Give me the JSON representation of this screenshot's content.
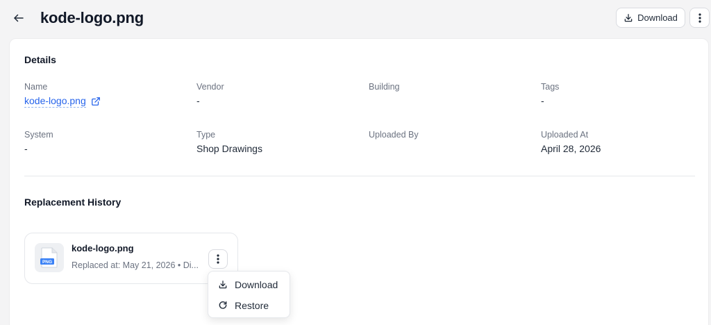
{
  "header": {
    "title": "kode-logo.png",
    "download_label": "Download",
    "icons": {
      "back": "arrow-left-icon",
      "download": "download-icon",
      "more": "kebab-vertical-icon"
    }
  },
  "details": {
    "section_title": "Details",
    "fields": {
      "name": {
        "label": "Name",
        "value": "kode-logo.png"
      },
      "vendor": {
        "label": "Vendor",
        "value": "-"
      },
      "building": {
        "label": "Building",
        "value": ""
      },
      "tags": {
        "label": "Tags",
        "value": "-"
      },
      "system": {
        "label": "System",
        "value": "-"
      },
      "type": {
        "label": "Type",
        "value": "Shop Drawings"
      },
      "uploaded_by": {
        "label": "Uploaded By",
        "value": ""
      },
      "uploaded_at": {
        "label": "Uploaded At",
        "value": "April 28, 2026"
      }
    }
  },
  "replacement_history": {
    "section_title": "Replacement History",
    "items": [
      {
        "file_name": "kode-logo.png",
        "meta": "Replaced at: May 21, 2026 • Di...",
        "badge": "PNG"
      }
    ]
  },
  "context_menu": {
    "items": [
      {
        "label": "Download",
        "icon": "download-icon"
      },
      {
        "label": "Restore",
        "icon": "restore-icon"
      }
    ]
  },
  "colors": {
    "link": "#2563eb",
    "background": "#f4f4f5",
    "card": "#ffffff",
    "png_badge": "#3b82f6"
  }
}
